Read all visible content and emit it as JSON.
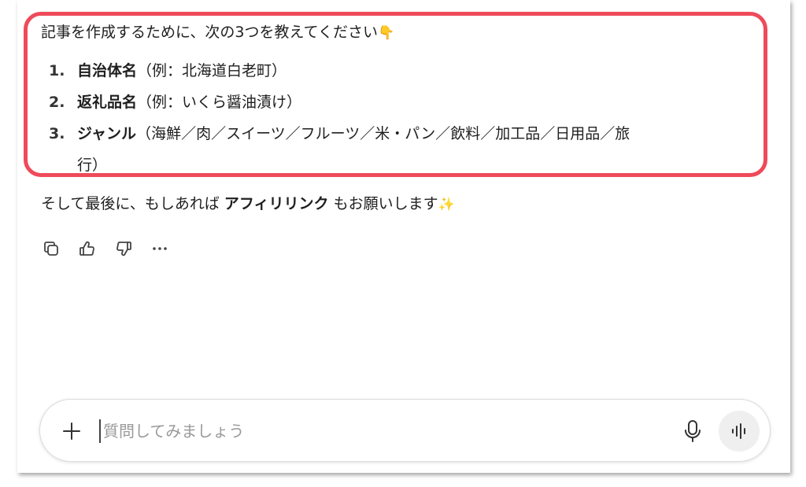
{
  "message": {
    "intro": "記事を作成するために、次の3つを教えてください",
    "intro_emoji": "👇",
    "items": [
      {
        "num": "1.",
        "term": "自治体名",
        "detail": "（例：北海道白老町）"
      },
      {
        "num": "2.",
        "term": "返礼品名",
        "detail": "（例：いくら醤油漬け）"
      },
      {
        "num": "3.",
        "term": "ジャンル",
        "detail": "（海鮮／肉／スイーツ／フルーツ／米・パン／飲料／加工品／日用品／旅",
        "detail_cont": "行）"
      }
    ],
    "closing_prefix": "そして最後に、もしあれば ",
    "closing_bold": "アフィリリンク",
    "closing_suffix": " もお願いします",
    "closing_emoji": "✨"
  },
  "actions": [
    "copy-icon",
    "thumbs-up-icon",
    "thumbs-down-icon",
    "more-options-icon"
  ],
  "composer": {
    "placeholder": "質問してみましょう",
    "value": ""
  },
  "colors": {
    "highlight_border": "#ef4a5a",
    "text": "#1f1f1f",
    "placeholder": "#9a9a9a",
    "voice_button_bg": "#efefef"
  }
}
